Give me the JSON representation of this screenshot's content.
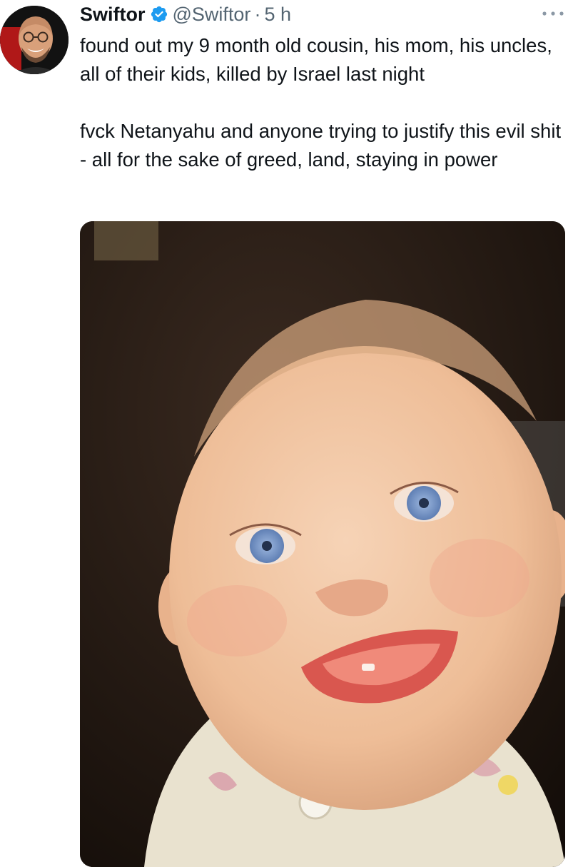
{
  "tweet": {
    "author": {
      "display_name": "Swiftor",
      "handle": "@Swiftor",
      "verified": true,
      "verified_icon": "verified-badge-icon",
      "avatar_icon": "profile-avatar"
    },
    "separator": "·",
    "time": "5 h",
    "text_paragraph_1": "found out my 9 month old cousin, his mom, his uncles, all of their kids, killed by Israel last night",
    "text_paragraph_2": "fvck Netanyahu and anyone trying to justify this evil shit - all for the sake of greed, land, staying in power",
    "media_icon": "attached-photo-of-smiling-baby",
    "more_icon": "more-options-icon"
  },
  "colors": {
    "text_primary": "#0f1419",
    "text_secondary": "#536471",
    "verified_blue": "#1d9bf0"
  }
}
